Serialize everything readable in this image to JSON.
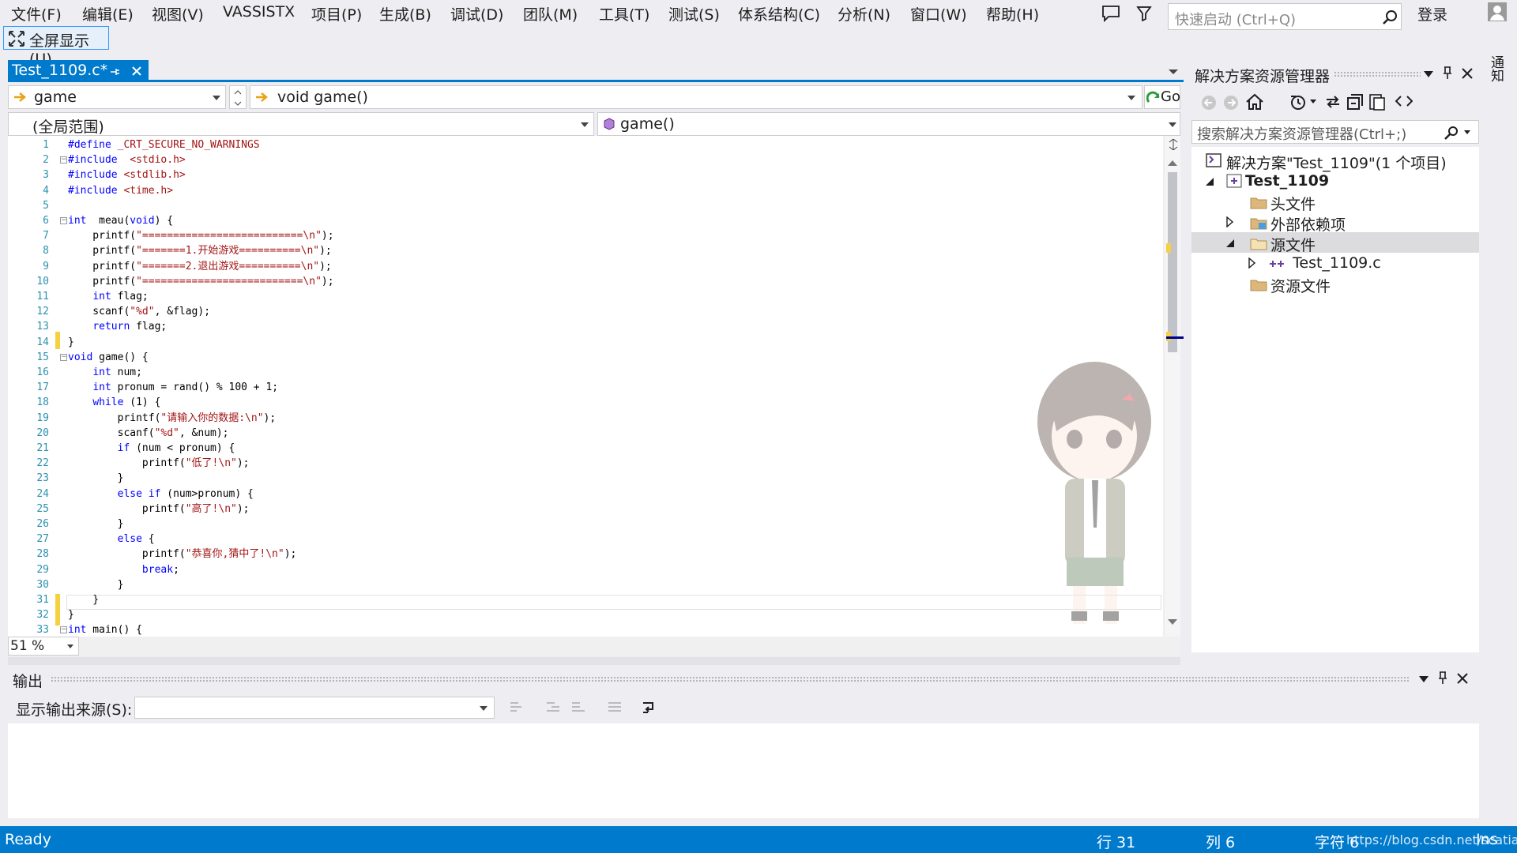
{
  "menu": [
    "文件(F)",
    "编辑(E)",
    "视图(V)",
    "VASSISTX",
    "项目(P)",
    "生成(B)",
    "调试(D)",
    "团队(M)",
    "工具(T)",
    "测试(S)",
    "体系结构(C)",
    "分析(N)",
    "窗口(W)",
    "帮助(H)"
  ],
  "quick_launch_placeholder": "快速启动 (Ctrl+Q)",
  "login_label": "登录",
  "fullscreen_label": "全屏显示(U)",
  "right_tool_label": "通知",
  "doc_tab": {
    "label": "Test_1109.c*"
  },
  "nav": {
    "symbol": "game",
    "member": "void game()",
    "go_label": "Go",
    "scope": "(全局范围)",
    "function": "game()"
  },
  "code_lines": [
    {
      "n": "1",
      "t": "#define _CRT_SECURE_NO_WARNINGS"
    },
    {
      "n": "2",
      "t": "#include  <stdio.h>"
    },
    {
      "n": "3",
      "t": "#include <stdlib.h>"
    },
    {
      "n": "4",
      "t": "#include <time.h>"
    },
    {
      "n": "5",
      "t": ""
    },
    {
      "n": "6",
      "t": "int  meau(void) {"
    },
    {
      "n": "7",
      "t": "    printf(\"==========================\\n\");"
    },
    {
      "n": "8",
      "t": "    printf(\"=======1.开始游戏==========\\n\");"
    },
    {
      "n": "9",
      "t": "    printf(\"=======2.退出游戏==========\\n\");"
    },
    {
      "n": "10",
      "t": "    printf(\"==========================\\n\");"
    },
    {
      "n": "11",
      "t": "    int flag;"
    },
    {
      "n": "12",
      "t": "    scanf(\"%d\", &flag);"
    },
    {
      "n": "13",
      "t": "    return flag;"
    },
    {
      "n": "14",
      "t": "}"
    },
    {
      "n": "15",
      "t": "void game() {"
    },
    {
      "n": "16",
      "t": "    int num;"
    },
    {
      "n": "17",
      "t": "    int pronum = rand() % 100 + 1;"
    },
    {
      "n": "18",
      "t": "    while (1) {"
    },
    {
      "n": "19",
      "t": "        printf(\"请输入你的数据:\\n\");"
    },
    {
      "n": "20",
      "t": "        scanf(\"%d\", &num);"
    },
    {
      "n": "21",
      "t": "        if (num < pronum) {"
    },
    {
      "n": "22",
      "t": "            printf(\"低了!\\n\");"
    },
    {
      "n": "23",
      "t": "        }"
    },
    {
      "n": "24",
      "t": "        else if (num>pronum) {"
    },
    {
      "n": "25",
      "t": "            printf(\"高了!\\n\");"
    },
    {
      "n": "26",
      "t": "        }"
    },
    {
      "n": "27",
      "t": "        else {"
    },
    {
      "n": "28",
      "t": "            printf(\"恭喜你,猜中了!\\n\");"
    },
    {
      "n": "29",
      "t": "            break;"
    },
    {
      "n": "30",
      "t": "        }"
    },
    {
      "n": "31",
      "t": "    }"
    },
    {
      "n": "32",
      "t": "}"
    },
    {
      "n": "33",
      "t": "int main() {"
    }
  ],
  "zoom": "51 %",
  "solution_explorer": {
    "title": "解决方案资源管理器",
    "search_placeholder": "搜索解决方案资源管理器(Ctrl+;)",
    "tree": [
      "解决方案\"Test_1109\"(1 个项目)",
      "Test_1109",
      "头文件",
      "外部依赖项",
      "源文件",
      "Test_1109.c",
      "资源文件"
    ]
  },
  "output": {
    "title": "输出",
    "source_label": "显示输出来源(S):"
  },
  "status": {
    "ready": "Ready",
    "line": "行 31",
    "col": "列 6",
    "char": "字符 6",
    "ins": "Ins",
    "watermark": "https://blog.csdn.net/scatiac"
  },
  "colors": {
    "accent": "#007acc",
    "keyword": "#0000ff",
    "string": "#a31515",
    "line_number": "#2b91af"
  }
}
